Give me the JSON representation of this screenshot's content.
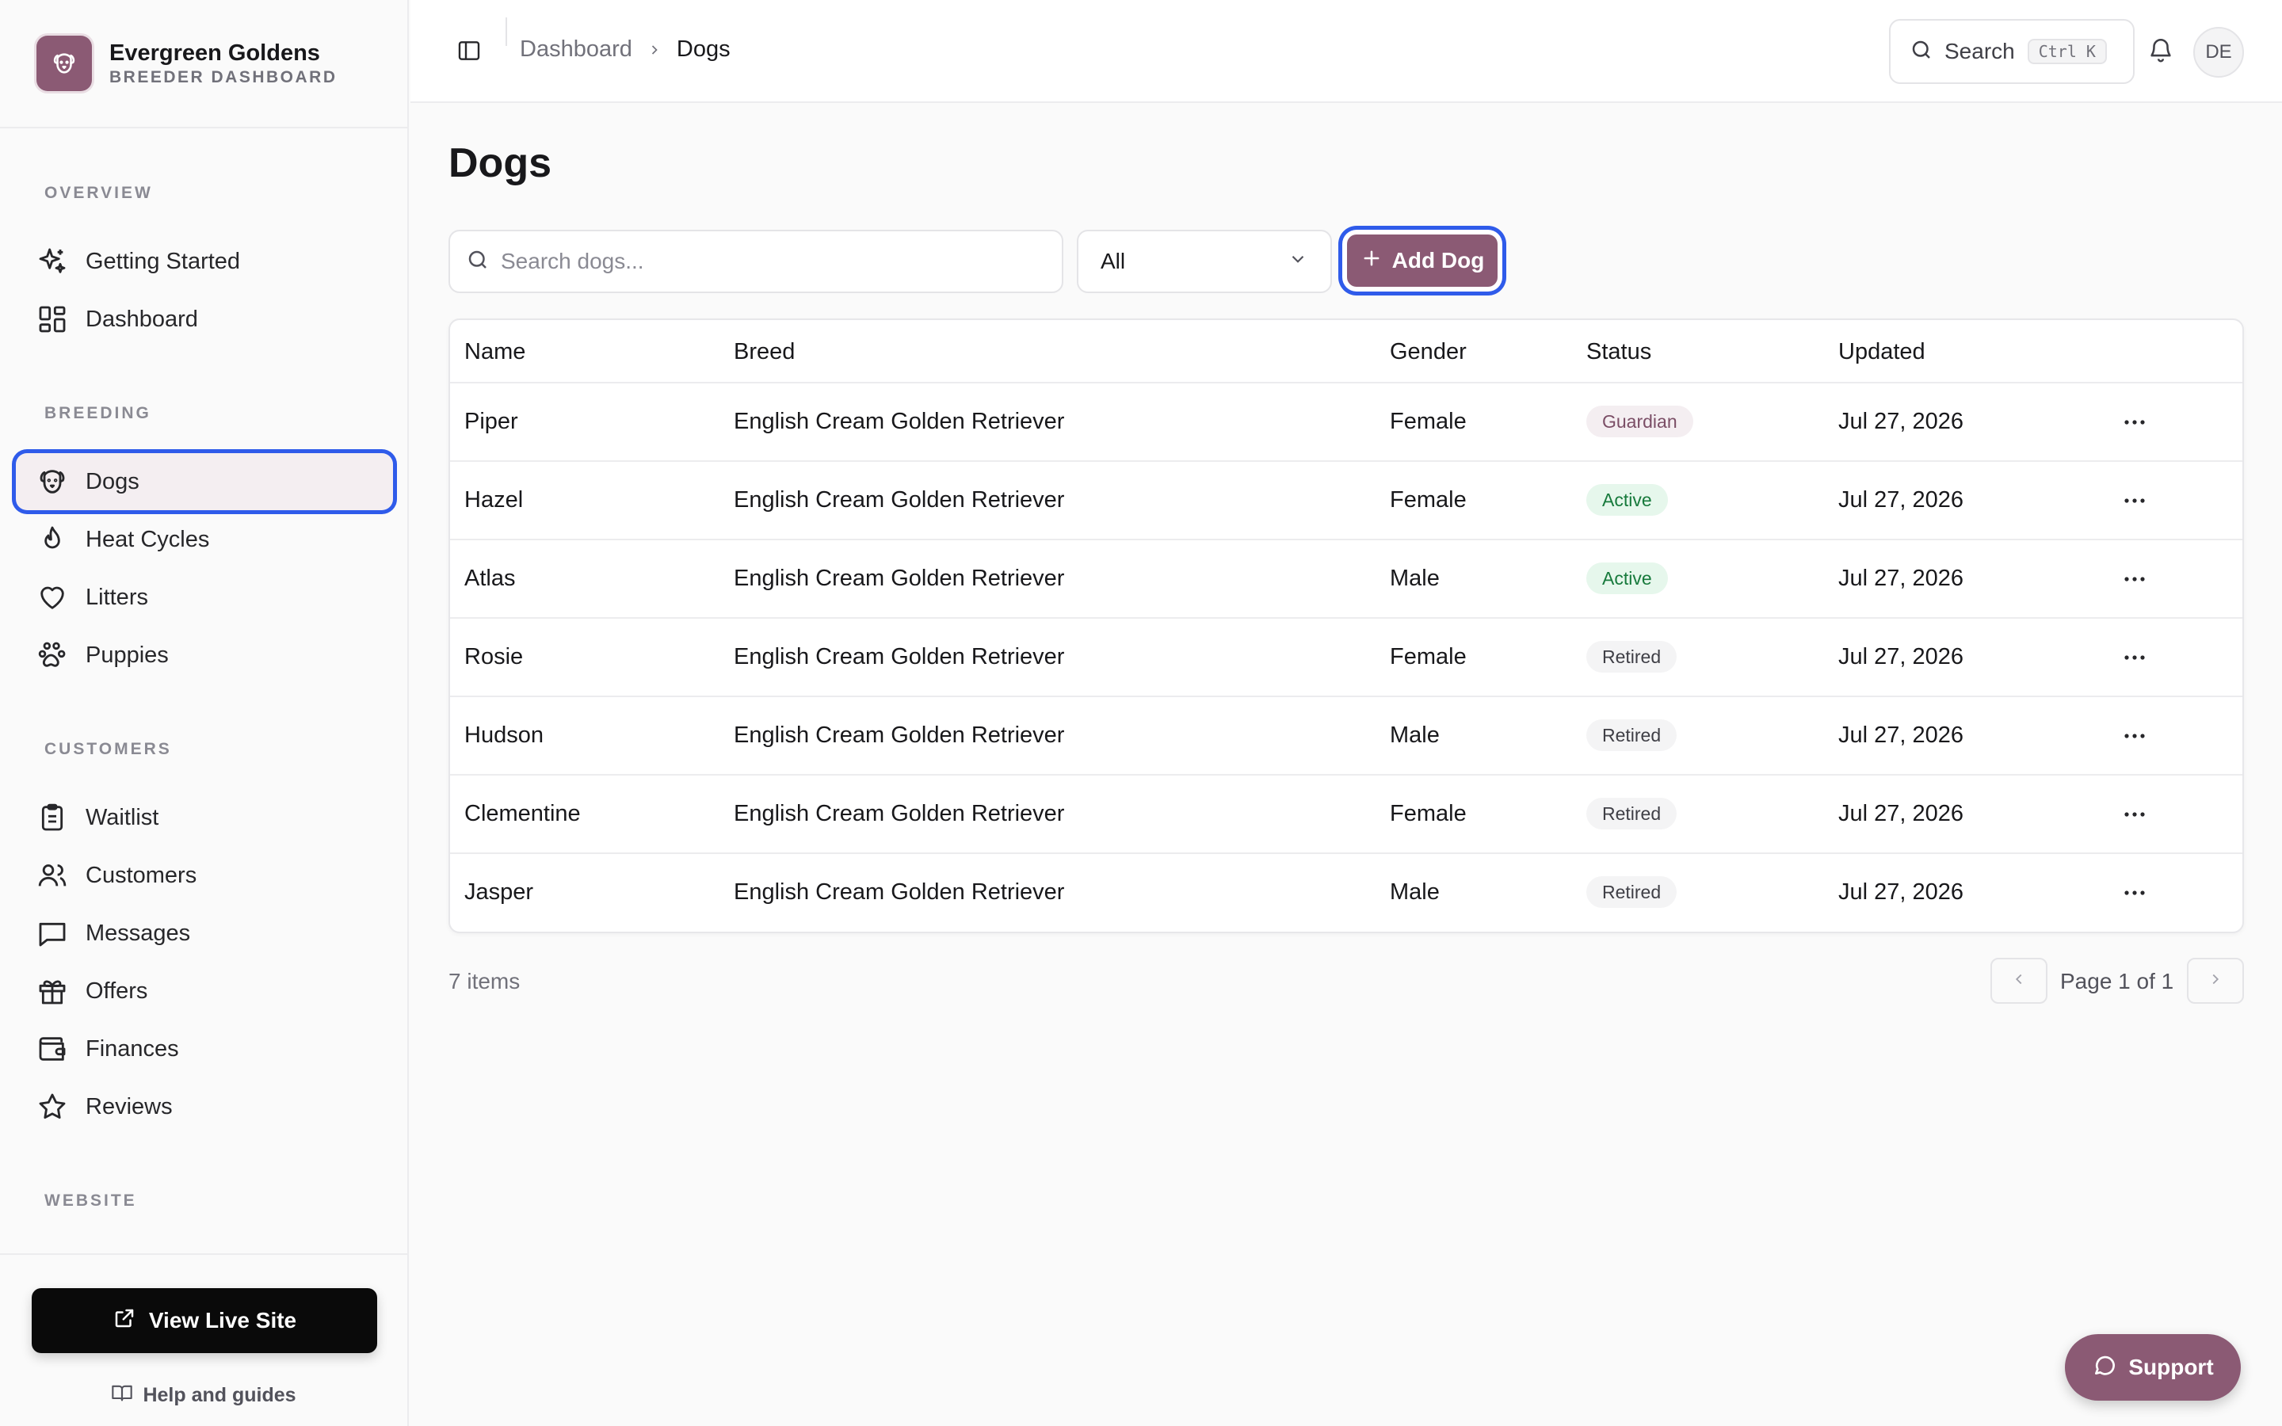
{
  "brand": {
    "name": "Evergreen Goldens",
    "subtitle": "BREEDER DASHBOARD"
  },
  "sidebar": {
    "sections": [
      {
        "label": "OVERVIEW"
      },
      {
        "label": "BREEDING"
      },
      {
        "label": "CUSTOMERS"
      },
      {
        "label": "WEBSITE"
      }
    ],
    "items": [
      {
        "label": "Getting Started",
        "icon": "sparkles-icon"
      },
      {
        "label": "Dashboard",
        "icon": "layout-grid-icon"
      },
      {
        "label": "Dogs",
        "icon": "dog-icon",
        "active": true
      },
      {
        "label": "Heat Cycles",
        "icon": "flame-icon"
      },
      {
        "label": "Litters",
        "icon": "heart-icon"
      },
      {
        "label": "Puppies",
        "icon": "paw-icon"
      },
      {
        "label": "Waitlist",
        "icon": "clipboard-list-icon"
      },
      {
        "label": "Customers",
        "icon": "users-icon"
      },
      {
        "label": "Messages",
        "icon": "message-square-icon"
      },
      {
        "label": "Offers",
        "icon": "gift-icon"
      },
      {
        "label": "Finances",
        "icon": "wallet-icon"
      },
      {
        "label": "Reviews",
        "icon": "star-icon"
      }
    ],
    "view_live_site": "View Live Site",
    "help": "Help and guides"
  },
  "header": {
    "breadcrumb": [
      "Dashboard",
      "Dogs"
    ],
    "search_label": "Search",
    "search_shortcut": "Ctrl K",
    "avatar_initials": "DE"
  },
  "main": {
    "title": "Dogs",
    "search_placeholder": "Search dogs...",
    "filter_value": "All",
    "add_button": "Add Dog",
    "columns": [
      "Name",
      "Breed",
      "Gender",
      "Status",
      "Updated"
    ],
    "rows": [
      {
        "name": "Piper",
        "breed": "English Cream Golden Retriever",
        "gender": "Female",
        "status": "Guardian",
        "updated": "Jul 27, 2026"
      },
      {
        "name": "Hazel",
        "breed": "English Cream Golden Retriever",
        "gender": "Female",
        "status": "Active",
        "updated": "Jul 27, 2026"
      },
      {
        "name": "Atlas",
        "breed": "English Cream Golden Retriever",
        "gender": "Male",
        "status": "Active",
        "updated": "Jul 27, 2026"
      },
      {
        "name": "Rosie",
        "breed": "English Cream Golden Retriever",
        "gender": "Female",
        "status": "Retired",
        "updated": "Jul 27, 2026"
      },
      {
        "name": "Hudson",
        "breed": "English Cream Golden Retriever",
        "gender": "Male",
        "status": "Retired",
        "updated": "Jul 27, 2026"
      },
      {
        "name": "Clementine",
        "breed": "English Cream Golden Retriever",
        "gender": "Female",
        "status": "Retired",
        "updated": "Jul 27, 2026"
      },
      {
        "name": "Jasper",
        "breed": "English Cream Golden Retriever",
        "gender": "Male",
        "status": "Retired",
        "updated": "Jul 27, 2026"
      }
    ],
    "item_count": "7 items",
    "page_label": "Page 1 of 1"
  },
  "support_button": "Support",
  "colors": {
    "brand": "#8b5a74",
    "focus_ring": "#2f5bea",
    "active_badge": "#177a3c",
    "guardian_badge": "#7b4e66"
  }
}
